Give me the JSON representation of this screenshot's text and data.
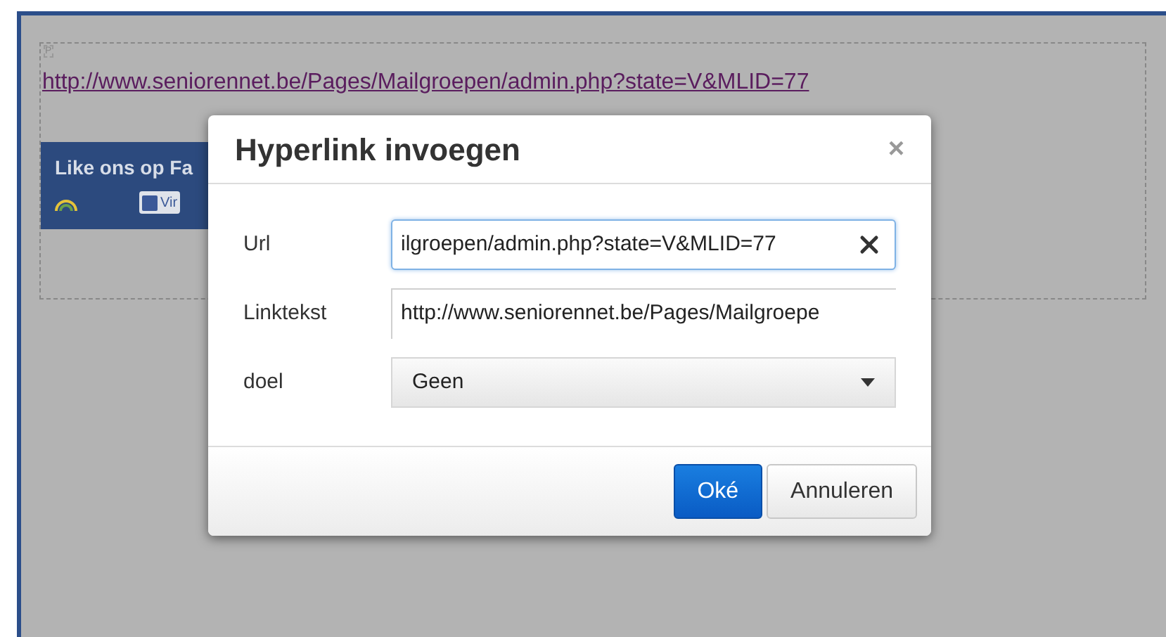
{
  "editor": {
    "marker": "P",
    "link": "http://www.seniorennet.be/Pages/Mailgroepen/admin.php?state=V&MLID=77"
  },
  "facebook_widget": {
    "title": "Like ons op Fa",
    "button": "Vir"
  },
  "dialog": {
    "title": "Hyperlink invoegen",
    "close": "×",
    "fields": [
      {
        "kind": "text",
        "label": "Url",
        "value": "ilgroepen/admin.php?state=V&MLID=77",
        "focused": true,
        "clearable": true
      },
      {
        "kind": "text",
        "label": "Linktekst",
        "value": "http://www.seniorennet.be/Pages/Mailgroepe",
        "focused": false,
        "clearable": false
      },
      {
        "kind": "select",
        "label": "doel",
        "value": "Geen"
      }
    ],
    "buttons": [
      {
        "label": "Oké",
        "primary": true
      },
      {
        "label": "Annuleren",
        "primary": false
      }
    ]
  }
}
